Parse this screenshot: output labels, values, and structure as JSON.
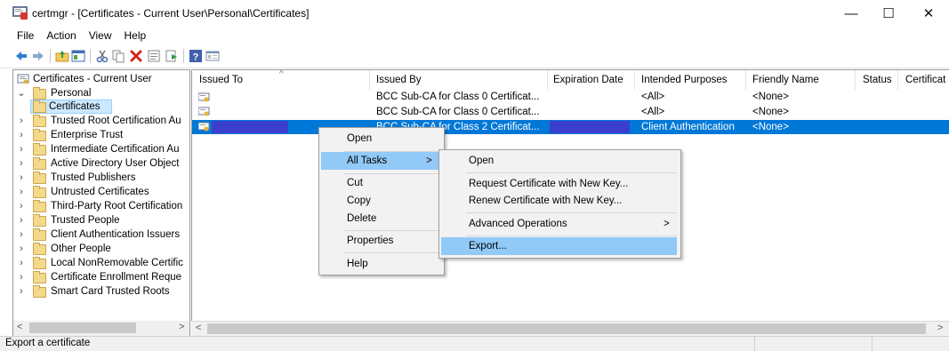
{
  "window": {
    "title": "certmgr - [Certificates - Current User\\Personal\\Certificates]",
    "minimize_glyph": "—",
    "maximize_glyph": "☐",
    "close_glyph": "✕"
  },
  "menubar": [
    "File",
    "Action",
    "View",
    "Help"
  ],
  "toolbar": {
    "icons": [
      "back-arrow-icon",
      "forward-arrow-icon",
      "up-folder-icon",
      "show-hide-tree-icon",
      "cut-icon",
      "copy-icon",
      "delete-icon",
      "properties-icon",
      "export-list-icon",
      "help-icon",
      "console-tree-icon"
    ]
  },
  "tree": {
    "root": "Certificates - Current User",
    "personal": "Personal",
    "certificates": "Certificates",
    "items": [
      "Trusted Root Certification Au",
      "Enterprise Trust",
      "Intermediate Certification Au",
      "Active Directory User Object",
      "Trusted Publishers",
      "Untrusted Certificates",
      "Third-Party Root Certification",
      "Trusted People",
      "Client Authentication Issuers",
      "Other People",
      "Local NonRemovable Certific",
      "Certificate Enrollment Reque",
      "Smart Card Trusted Roots"
    ],
    "scroll_left": "<",
    "scroll_right": ">"
  },
  "list": {
    "columns": [
      "Issued To",
      "Issued By",
      "Expiration Date",
      "Intended Purposes",
      "Friendly Name",
      "Status",
      "Certificat"
    ],
    "sort_indicator": "^",
    "rows": [
      {
        "issued_to": "",
        "issued_by": "BCC Sub-CA for Class 0 Certificat...",
        "expiration": "",
        "purposes": "<All>",
        "friendly": "<None>"
      },
      {
        "issued_to": "",
        "issued_by": "BCC Sub-CA for Class 0 Certificat...",
        "expiration": "",
        "purposes": "<All>",
        "friendly": "<None>"
      },
      {
        "issued_to": "",
        "issued_by": "BCC Sub-CA for Class 2 Certificat...",
        "expiration": "",
        "purposes": "Client Authentication",
        "friendly": "<None>"
      }
    ],
    "scroll_left": "<",
    "scroll_right": ">"
  },
  "context_menu": {
    "open": "Open",
    "all_tasks": "All Tasks",
    "all_tasks_arrow": ">",
    "cut": "Cut",
    "copy": "Copy",
    "delete": "Delete",
    "properties": "Properties",
    "help": "Help"
  },
  "submenu": {
    "open": "Open",
    "request_new_key": "Request Certificate with New Key...",
    "renew_new_key": "Renew Certificate with New Key...",
    "advanced": "Advanced Operations",
    "advanced_arrow": ">",
    "export": "Export..."
  },
  "status": {
    "text": "Export a certificate"
  },
  "colors": {
    "selection": "#0078d7",
    "redaction": "#3b3fce",
    "menu_highlight": "#91c9f7",
    "tree_selection": "#cce8ff"
  }
}
